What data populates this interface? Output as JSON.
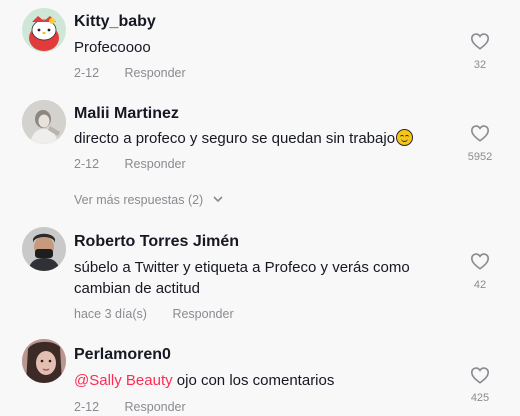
{
  "comments": [
    {
      "author": "Kitty_baby",
      "text": "Profecoooo",
      "date": "2-12",
      "reply_label": "Responder",
      "likes": "32",
      "avatar_icon": "hello-kitty-avatar"
    },
    {
      "author": "Malii Martinez",
      "text": "directo a profeco y seguro se quedan sin trabajo",
      "emoji": "relieved-face-emoji",
      "date": "2-12",
      "reply_label": "Responder",
      "likes": "5952",
      "avatar_icon": "user-photo-avatar"
    },
    {
      "author": "Roberto Torres Jimén",
      "text": "súbelo a Twitter y etiqueta a Profeco y verás como cambian de actitud",
      "date": "hace 3 día(s)",
      "reply_label": "Responder",
      "likes": "42",
      "avatar_icon": "user-photo-avatar"
    },
    {
      "author": "Perlamoren0",
      "mention": "@Sally Beauty",
      "text": " ojo con los comentarios",
      "date": "2-12",
      "reply_label": "Responder",
      "likes": "425",
      "avatar_icon": "user-photo-avatar"
    }
  ],
  "view_more_replies": "Ver más respuestas (2)",
  "colors": {
    "background": "#f8f8f8",
    "text": "#161823",
    "muted": "#8a8b91",
    "mention": "#fe2c55"
  }
}
